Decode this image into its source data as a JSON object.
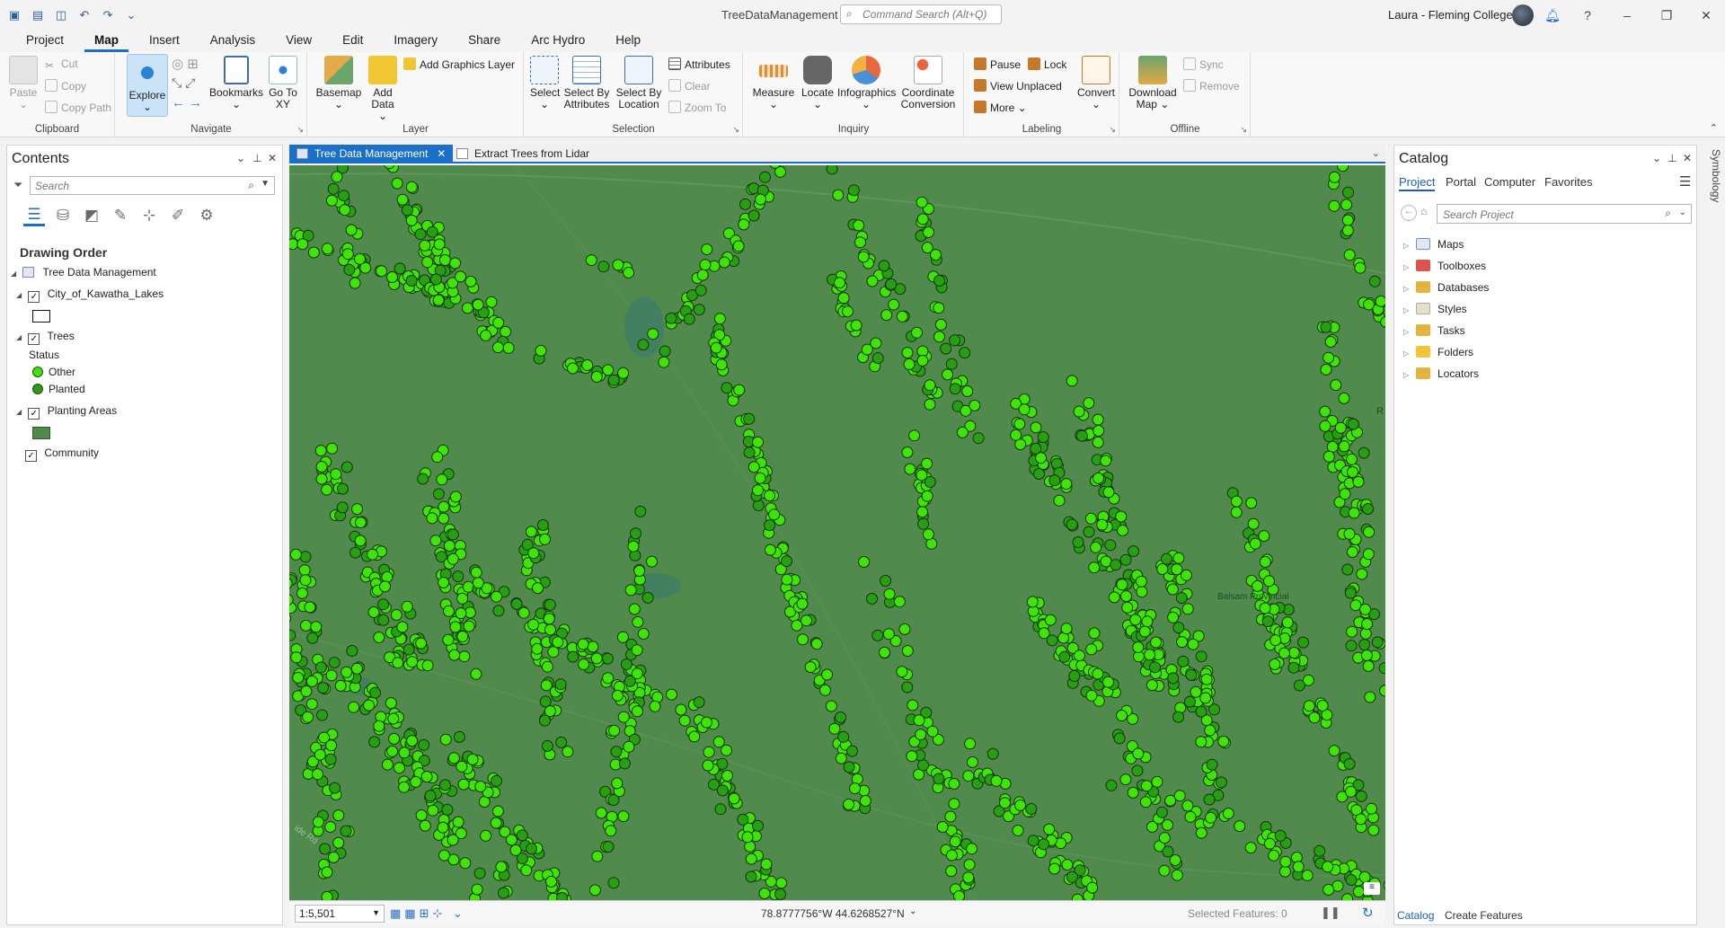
{
  "window": {
    "title": "TreeDataManagement",
    "command_search_placeholder": "Command Search (Alt+Q)",
    "user": "Laura - Fleming College"
  },
  "ribbon_tabs": [
    "Project",
    "Map",
    "Insert",
    "Analysis",
    "View",
    "Edit",
    "Imagery",
    "Share",
    "Arc Hydro",
    "Help"
  ],
  "active_ribbon_tab": "Map",
  "ribbon": {
    "clipboard": {
      "label": "Clipboard",
      "paste": "Paste",
      "cut": "Cut",
      "copy": "Copy",
      "copy_path": "Copy Path"
    },
    "navigate": {
      "label": "Navigate",
      "explore": "Explore",
      "bookmarks": "Bookmarks",
      "go_to_xy": "Go To XY"
    },
    "layer": {
      "label": "Layer",
      "basemap": "Basemap",
      "add_data": "Add Data",
      "add_graphics_layer": "Add Graphics Layer"
    },
    "selection": {
      "label": "Selection",
      "select": "Select",
      "select_by_attributes": "Select By Attributes",
      "select_by_location": "Select By Location",
      "attributes": "Attributes",
      "clear": "Clear",
      "zoom_to": "Zoom To"
    },
    "inquiry": {
      "label": "Inquiry",
      "measure": "Measure",
      "locate": "Locate",
      "infographics": "Infographics",
      "coordinate_conversion": "Coordinate Conversion"
    },
    "labeling": {
      "label": "Labeling",
      "pause": "Pause",
      "lock": "Lock",
      "view_unplaced": "View Unplaced",
      "more": "More",
      "convert": "Convert"
    },
    "offline": {
      "label": "Offline",
      "download_map": "Download Map",
      "sync": "Sync",
      "remove": "Remove"
    }
  },
  "contents": {
    "title": "Contents",
    "search_placeholder": "Search",
    "drawing_order": "Drawing Order",
    "map_name": "Tree Data Management",
    "layers": {
      "city": "City_of_Kawatha_Lakes",
      "trees": "Trees",
      "status_heading": "Status",
      "status_other": "Other",
      "status_planted": "Planted",
      "planting_areas": "Planting Areas",
      "community": "Community"
    },
    "colors": {
      "other": "#39e600",
      "planted": "#2d9a12",
      "planting_area": "#4f8a4a"
    }
  },
  "map_tabs": [
    "Tree Data Management",
    "Extract Trees from Lidar"
  ],
  "map_view": {
    "scale": "1:5,501",
    "coordinates": "78.8777756°W 44.6268527°N",
    "selected_features": "Selected Features: 0",
    "labels": {
      "park": "Balsam Provincial",
      "road": "ide Rd",
      "edge": "R"
    },
    "colors": {
      "background": "#508a4d",
      "bright_tree": "#3ce600",
      "dark_tree": "#24a010"
    }
  },
  "catalog": {
    "title": "Catalog",
    "tabs": [
      "Project",
      "Portal",
      "Computer",
      "Favorites"
    ],
    "active_tab": "Project",
    "search_placeholder": "Search Project",
    "items": [
      "Maps",
      "Toolboxes",
      "Databases",
      "Styles",
      "Tasks",
      "Folders",
      "Locators"
    ],
    "bottom_tabs": [
      "Catalog",
      "Create Features"
    ]
  },
  "side_tab": "Symbology"
}
